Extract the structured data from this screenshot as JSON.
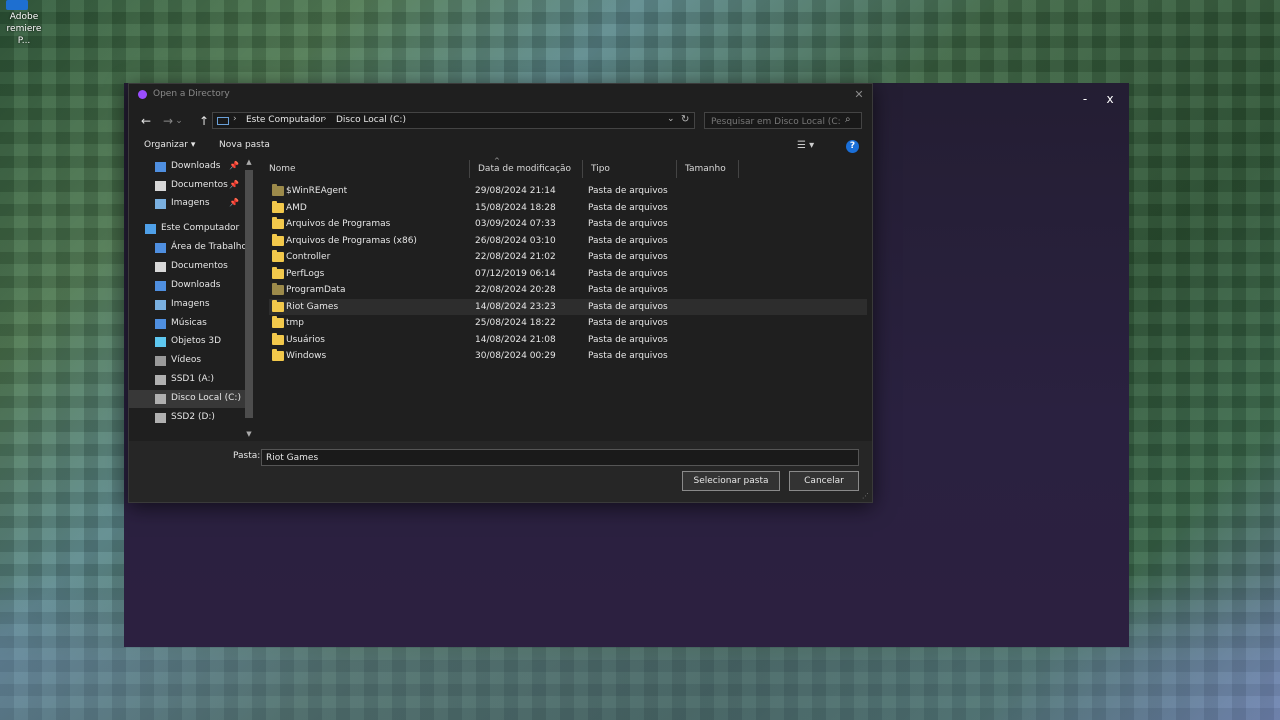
{
  "desktop": {
    "icon_label": "Adobe\nremiere P..."
  },
  "app_window": {
    "minimize": "-",
    "close": "x"
  },
  "dialog": {
    "title": "Open a Directory",
    "close": "✕",
    "nav": {
      "back": "←",
      "forward": "→",
      "dropdown": "⌄",
      "up": "↑",
      "refresh": "↻",
      "address_dropdown": "⌄"
    },
    "breadcrumb": [
      "Este Computador",
      "Disco Local (C:)"
    ],
    "search_placeholder": "Pesquisar em Disco Local (C:)",
    "toolbar": {
      "organize": "Organizar ▾",
      "new_folder": "Nova pasta",
      "help": "?"
    },
    "sidebar": [
      {
        "label": "Downloads",
        "icon": "download-icon",
        "pinned": true,
        "color": "#4f8fe0"
      },
      {
        "label": "Documentos",
        "icon": "document-icon",
        "pinned": true,
        "color": "#d8d8d8"
      },
      {
        "label": "Imagens",
        "icon": "image-icon",
        "pinned": true,
        "color": "#7ab0e0"
      },
      {
        "label": "Este Computador",
        "icon": "computer-icon",
        "pinned": false,
        "color": "#4fa0e8"
      },
      {
        "label": "Área de Trabalho",
        "icon": "desktop-icon",
        "pinned": false,
        "color": "#4f8fe0"
      },
      {
        "label": "Documentos",
        "icon": "document-icon",
        "pinned": false,
        "color": "#d8d8d8"
      },
      {
        "label": "Downloads",
        "icon": "download-icon",
        "pinned": false,
        "color": "#4f8fe0"
      },
      {
        "label": "Imagens",
        "icon": "image-icon",
        "pinned": false,
        "color": "#7ab0e0"
      },
      {
        "label": "Músicas",
        "icon": "music-icon",
        "pinned": false,
        "color": "#4f8fe0"
      },
      {
        "label": "Objetos 3D",
        "icon": "cube-icon",
        "pinned": false,
        "color": "#5ec8f0"
      },
      {
        "label": "Vídeos",
        "icon": "video-icon",
        "pinned": false,
        "color": "#9a9a9a"
      },
      {
        "label": "SSD1 (A:)",
        "icon": "drive-icon",
        "pinned": false,
        "color": "#b0b0b0"
      },
      {
        "label": "Disco Local (C:)",
        "icon": "drive-icon",
        "pinned": false,
        "color": "#b0b0b0",
        "selected": true
      },
      {
        "label": "SSD2 (D:)",
        "icon": "drive-icon",
        "pinned": false,
        "color": "#b0b0b0"
      }
    ],
    "pin_glyph": "📌",
    "columns": [
      "Nome",
      "Data de modificação",
      "Tipo",
      "Tamanho"
    ],
    "files": [
      {
        "name": "$WinREAgent",
        "date": "29/08/2024 21:14",
        "type": "Pasta de arquivos",
        "dim": true
      },
      {
        "name": "AMD",
        "date": "15/08/2024 18:28",
        "type": "Pasta de arquivos"
      },
      {
        "name": "Arquivos de Programas",
        "date": "03/09/2024 07:33",
        "type": "Pasta de arquivos"
      },
      {
        "name": "Arquivos de Programas (x86)",
        "date": "26/08/2024 03:10",
        "type": "Pasta de arquivos"
      },
      {
        "name": "Controller",
        "date": "22/08/2024 21:02",
        "type": "Pasta de arquivos"
      },
      {
        "name": "PerfLogs",
        "date": "07/12/2019 06:14",
        "type": "Pasta de arquivos"
      },
      {
        "name": "ProgramData",
        "date": "22/08/2024 20:28",
        "type": "Pasta de arquivos",
        "dim": true
      },
      {
        "name": "Riot Games",
        "date": "14/08/2024 23:23",
        "type": "Pasta de arquivos",
        "highlighted": true
      },
      {
        "name": "tmp",
        "date": "25/08/2024 18:22",
        "type": "Pasta de arquivos"
      },
      {
        "name": "Usuários",
        "date": "14/08/2024 21:08",
        "type": "Pasta de arquivos"
      },
      {
        "name": "Windows",
        "date": "30/08/2024 00:29",
        "type": "Pasta de arquivos"
      }
    ],
    "folder_label": "Pasta:",
    "folder_value": "Riot Games",
    "select_button": "Selecionar pasta",
    "cancel_button": "Cancelar"
  }
}
